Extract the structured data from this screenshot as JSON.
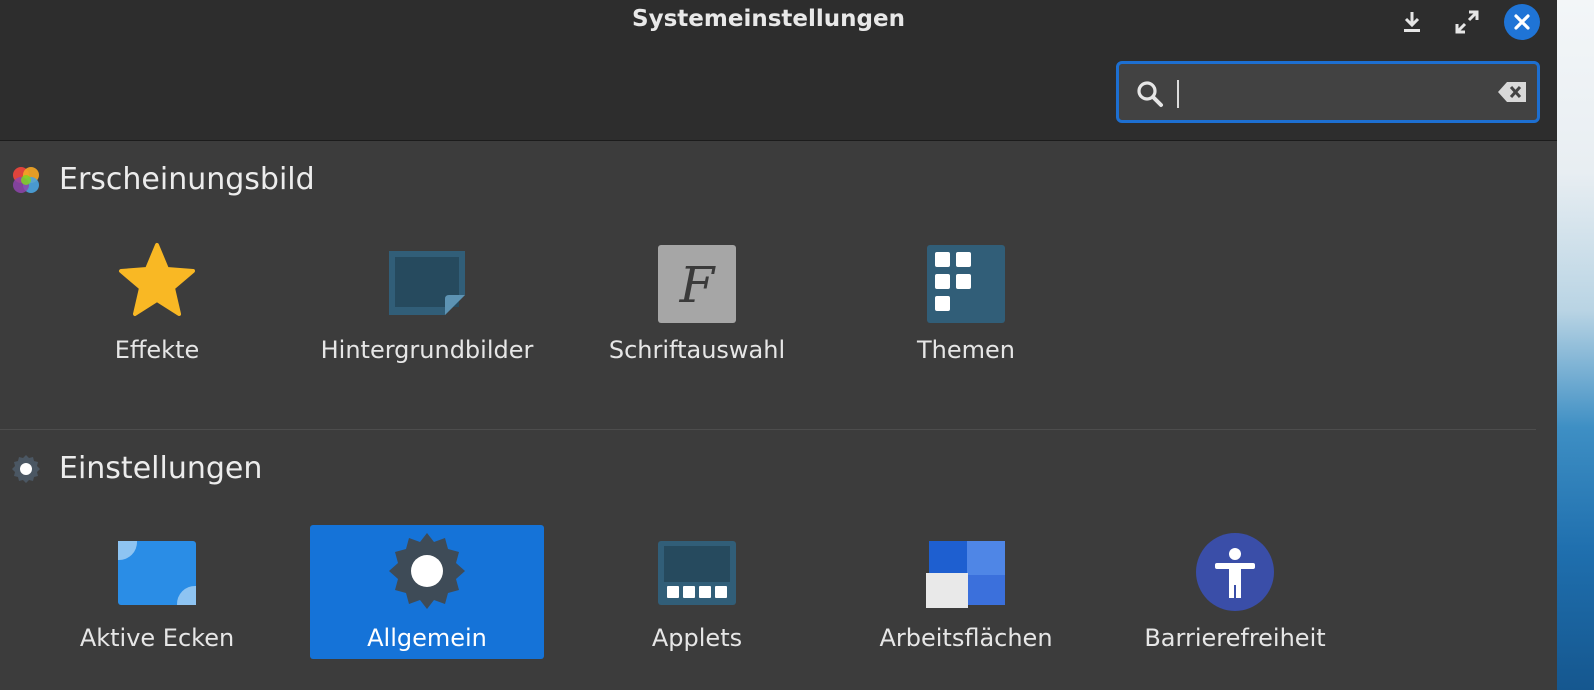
{
  "window": {
    "title": "Systemeinstellungen",
    "buttons": {
      "minimize": "download-icon",
      "maximize": "maximize-icon",
      "close": "close-icon"
    }
  },
  "search": {
    "value": "",
    "placeholder": ""
  },
  "sections": [
    {
      "title": "Erscheinungsbild",
      "icon": "appearance-icon",
      "items": [
        {
          "label": "Effekte",
          "icon": "star-icon"
        },
        {
          "label": "Hintergrundbilder",
          "icon": "wallpaper-icon"
        },
        {
          "label": "Schriftauswahl",
          "icon": "font-icon"
        },
        {
          "label": "Themen",
          "icon": "themes-icon"
        }
      ]
    },
    {
      "title": "Einstellungen",
      "icon": "settings-icon",
      "items": [
        {
          "label": "Aktive Ecken",
          "icon": "hot-corners-icon"
        },
        {
          "label": "Allgemein",
          "icon": "gear-icon",
          "selected": true
        },
        {
          "label": "Applets",
          "icon": "applets-icon"
        },
        {
          "label": "Arbeitsflächen",
          "icon": "workspaces-icon"
        },
        {
          "label": "Barrierefreiheit",
          "icon": "accessibility-icon"
        }
      ]
    }
  ],
  "colors": {
    "accent": "#1573d8",
    "header": "#2d2d2d",
    "background": "#3c3c3c"
  }
}
